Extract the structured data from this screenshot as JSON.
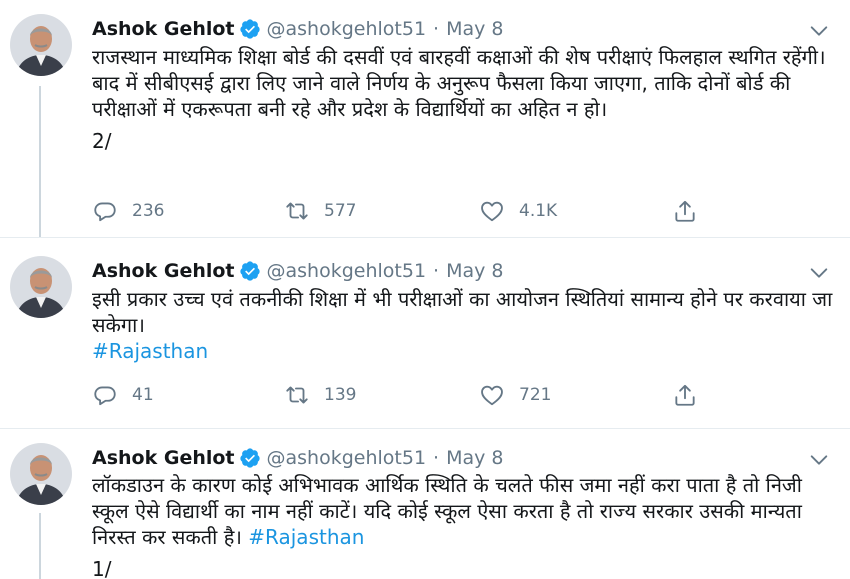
{
  "tweets": [
    {
      "name": "Ashok Gehlot",
      "handle": "@ashokgehlot51",
      "separator": "·",
      "date": "May 8",
      "text": "राजस्थान माध्यमिक शिक्षा बोर्ड की दसवीं एवं बारहवीं कक्षाओं की शेष परीक्षाएं फिलहाल स्थगित रहेंगी। बाद में सीबीएसई द्वारा लिए जाने वाले निर्णय के अनुरूप फैसला किया जाएगा, ताकि दोनों बोर्ड की परीक्षाओं में एकरूपता बनी रहे और प्रदेश के विद्यार्थियों का अहित न हो।",
      "thread_number": "2/",
      "replies": "236",
      "retweets": "577",
      "likes": "4.1K"
    },
    {
      "name": "Ashok Gehlot",
      "handle": "@ashokgehlot51",
      "separator": "·",
      "date": "May 8",
      "text": "इसी प्रकार उच्च एवं तकनीकी शिक्षा में भी परीक्षाओं का आयोजन स्थितियां सामान्य होने पर करवाया जा सकेगा।",
      "hashtag": "#Rajasthan",
      "replies": "41",
      "retweets": "139",
      "likes": "721"
    },
    {
      "name": "Ashok Gehlot",
      "handle": "@ashokgehlot51",
      "separator": "·",
      "date": "May 8",
      "text": "लॉकडाउन के कारण कोई अभिभावक आर्थिक स्थिति के चलते फीस जमा नहीं करा पाता है तो निजी स्कूल ऐसे विद्यार्थी का नाम नहीं काटें। यदि कोई स्कूल ऐसा करता है तो राज्य सरकार उसकी मान्यता निरस्त कर सकती है।",
      "hashtag": "#Rajasthan",
      "thread_number": "1/"
    }
  ],
  "icons": {
    "verified": "verified-badge-icon",
    "caret": "chevron-down-icon",
    "reply": "reply-bubble-icon",
    "retweet": "retweet-icon",
    "like": "heart-icon",
    "share": "share-upload-icon"
  },
  "colors": {
    "text": "#14171a",
    "muted": "#657786",
    "link": "#1b95e0",
    "verified": "#1da1f2",
    "divider": "#e6ecf0"
  }
}
